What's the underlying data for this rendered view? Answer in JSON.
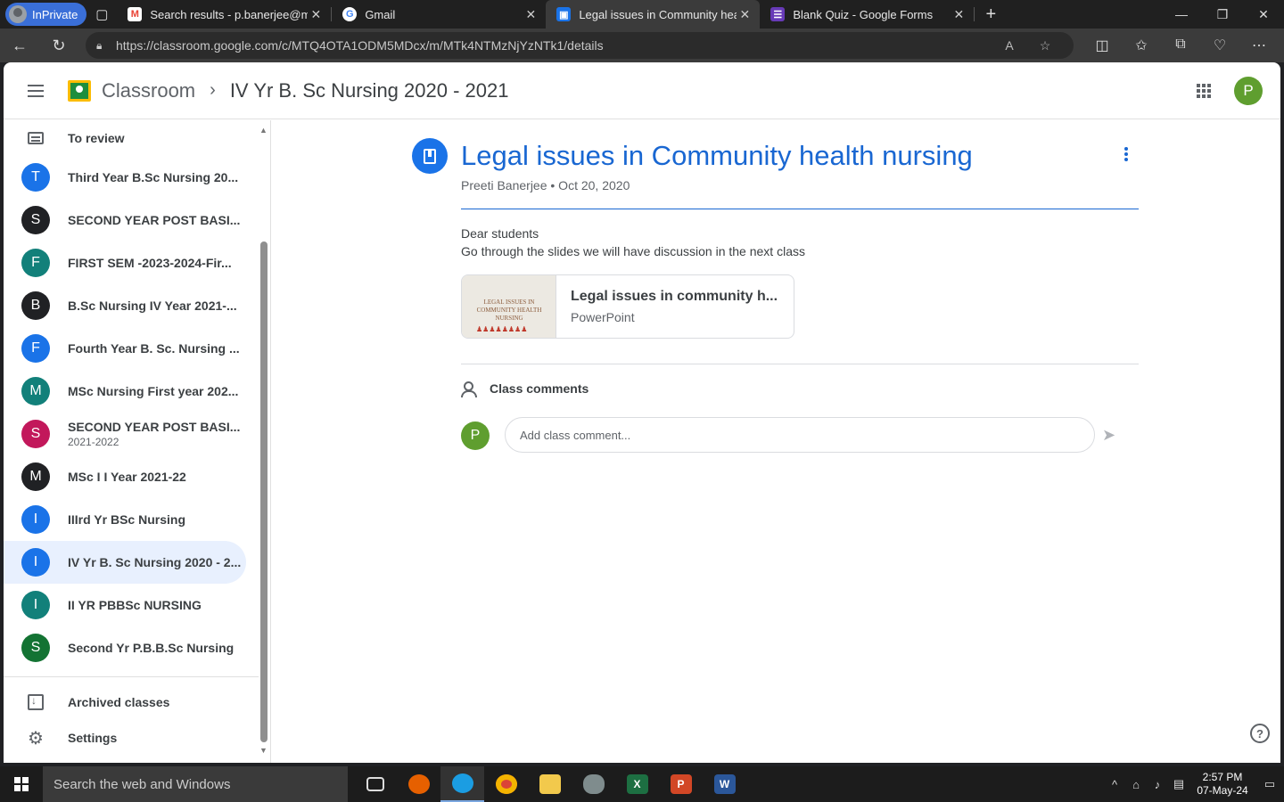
{
  "browser": {
    "inprivate_label": "InPrivate",
    "tabs": [
      {
        "title": "Search results - p.banerjee@mgm",
        "icon": "gmail-icon",
        "color": "#ea4335",
        "glyph": "M"
      },
      {
        "title": "Gmail",
        "icon": "google-icon",
        "color": "#4285f4",
        "glyph": "G"
      },
      {
        "title": "Legal issues in Community health",
        "icon": "classroom-icon",
        "color": "#1a73e8",
        "glyph": "▣"
      },
      {
        "title": "Blank Quiz - Google Forms",
        "icon": "forms-icon",
        "color": "#673ab7",
        "glyph": "☰"
      }
    ],
    "url": "https://classroom.google.com/c/MTQ4OTA1ODM5MDcx/m/MTk4NTMzNjYzNTk1/details"
  },
  "app": {
    "brand": "Classroom",
    "course": "IV Yr B. Sc Nursing 2020 - 2021",
    "user_initial": "P",
    "accent": "#1967d2"
  },
  "sidebar": {
    "to_review": "To review",
    "items": [
      {
        "initial": "T",
        "label": "Third Year B.Sc Nursing 20...",
        "color": "#1a73e8"
      },
      {
        "initial": "S",
        "label": "SECOND YEAR POST BASI...",
        "color": "#202124"
      },
      {
        "initial": "F",
        "label": "FIRST SEM -2023-2024-Fir...",
        "color": "#12807a"
      },
      {
        "initial": "B",
        "label": "B.Sc Nursing IV Year 2021-...",
        "color": "#202124"
      },
      {
        "initial": "F",
        "label": "Fourth Year B. Sc. Nursing ...",
        "color": "#1a73e8"
      },
      {
        "initial": "M",
        "label": "MSc Nursing First year 202...",
        "color": "#12807a"
      },
      {
        "initial": "S",
        "label": "SECOND YEAR POST BASI...",
        "sub": "2021-2022",
        "color": "#c2185b"
      },
      {
        "initial": "M",
        "label": "MSc I I Year 2021-22",
        "color": "#202124"
      },
      {
        "initial": "I",
        "label": "IIIrd Yr BSc Nursing",
        "color": "#1a73e8"
      },
      {
        "initial": "I",
        "label": "IV Yr B. Sc Nursing 2020 - 2...",
        "color": "#1a73e8",
        "selected": true
      },
      {
        "initial": "I",
        "label": "II YR PBBSc NURSING",
        "color": "#12807a"
      },
      {
        "initial": "S",
        "label": "Second Yr P.B.B.Sc Nursing",
        "color": "#137333"
      }
    ],
    "archived": "Archived classes",
    "settings": "Settings"
  },
  "post": {
    "title": "Legal issues in Community health nursing",
    "meta": "Preeti Banerjee • Oct 20, 2020",
    "body_line1": "Dear students",
    "body_line2": "Go through the slides we will have discussion in the next class",
    "attachment": {
      "title": "Legal issues in community h...",
      "type": "PowerPoint",
      "thumb_text": "LEGAL ISSUES IN COMMUNITY HEALTH NURSING"
    },
    "comments_heading": "Class comments",
    "comment_placeholder": "Add class comment..."
  },
  "taskbar": {
    "search_placeholder": "Search the web and Windows",
    "time": "2:57 PM",
    "date": "07-May-24"
  }
}
